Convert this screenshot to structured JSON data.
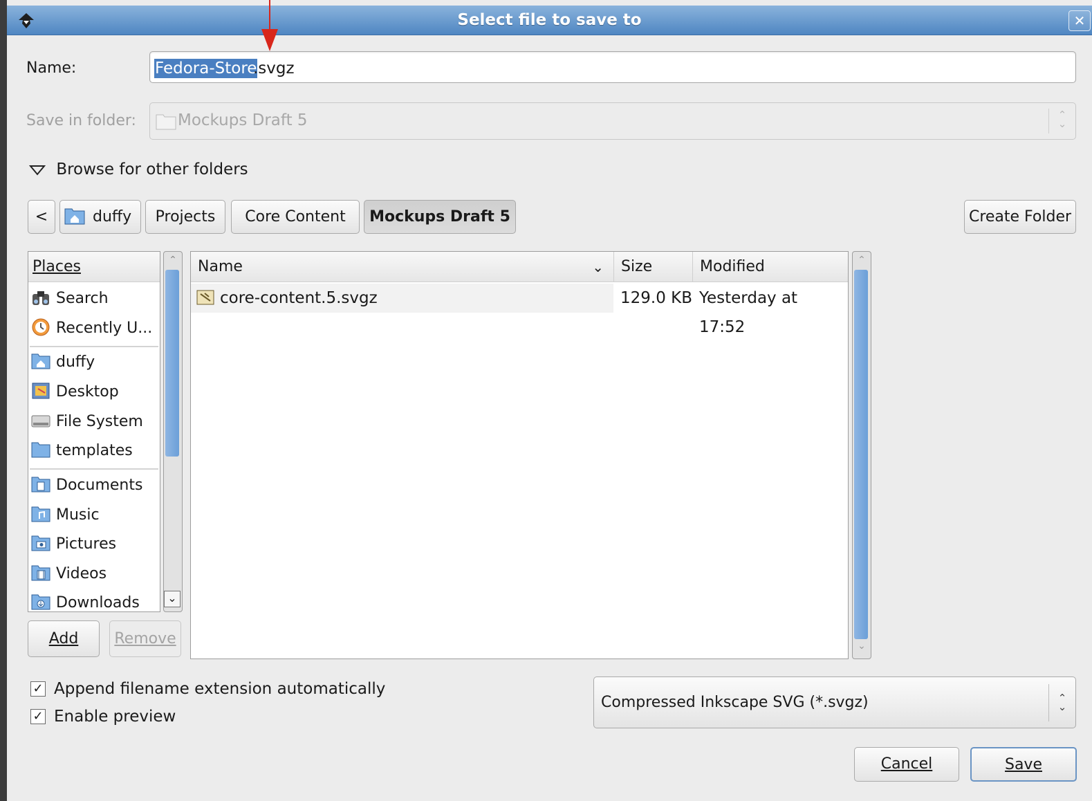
{
  "window": {
    "title": "Select file to save to",
    "close_glyph": "✕"
  },
  "name_field": {
    "label": "Name:",
    "value_selected": "Fedora-Store",
    "value_rest": ".svgz"
  },
  "folder_field": {
    "label": "Save in folder:",
    "value": "Mockups Draft 5"
  },
  "browse_toggle": {
    "label": "Browse for other folders",
    "expanded": true
  },
  "path_bar": {
    "back_glyph": "<",
    "segments": [
      "duffy",
      "Projects",
      "Core Content",
      "Mockups Draft 5"
    ],
    "active_index": 3
  },
  "create_folder_label": "Create Folder",
  "places": {
    "header": "Places",
    "items": [
      {
        "label": "Search",
        "icon": "binoculars-icon"
      },
      {
        "label": "Recently U...",
        "icon": "recent-icon"
      },
      {
        "label": "duffy",
        "icon": "home-folder-icon"
      },
      {
        "label": "Desktop",
        "icon": "desktop-icon"
      },
      {
        "label": "File System",
        "icon": "drive-icon"
      },
      {
        "label": "templates",
        "icon": "folder-icon"
      },
      {
        "label": "Documents",
        "icon": "documents-folder-icon"
      },
      {
        "label": "Music",
        "icon": "music-folder-icon"
      },
      {
        "label": "Pictures",
        "icon": "pictures-folder-icon"
      },
      {
        "label": "Videos",
        "icon": "videos-folder-icon"
      },
      {
        "label": "Downloads",
        "icon": "downloads-folder-icon"
      }
    ],
    "add_label": "Add",
    "remove_label": "Remove"
  },
  "files": {
    "columns": {
      "name": "Name",
      "size": "Size",
      "modified": "Modified"
    },
    "rows": [
      {
        "name": "core-content.5.svgz",
        "size": "129.0 KB",
        "modified": "Yesterday at 17:52",
        "icon": "svg-image-icon"
      }
    ]
  },
  "options": {
    "append_extension": {
      "label": "Append filename extension automatically",
      "checked": true
    },
    "enable_preview": {
      "label": "Enable preview",
      "checked": true
    }
  },
  "filetype": {
    "value": "Compressed Inkscape SVG (*.svgz)"
  },
  "buttons": {
    "cancel": "Cancel",
    "save": "Save"
  },
  "colors": {
    "titlebar": "#5b8fc8",
    "selection": "#4a7fc1",
    "annotation_arrow": "#d8261b",
    "scroll_thumb": "#7aa9de"
  }
}
